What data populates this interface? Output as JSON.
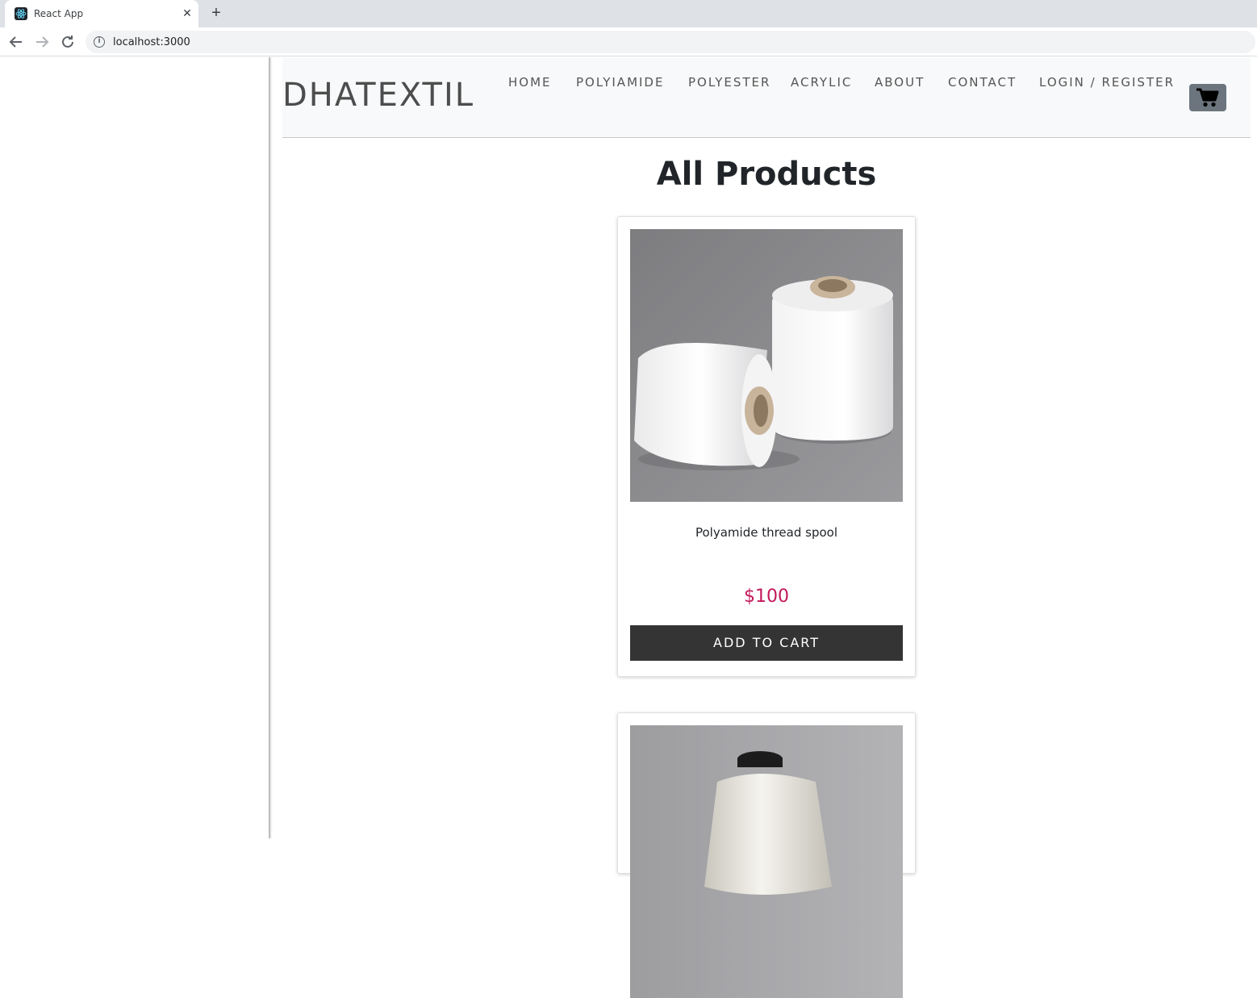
{
  "browser": {
    "tab_title": "React App",
    "tab_close": "✕",
    "new_tab": "+",
    "url": "localhost:3000",
    "info": "i"
  },
  "header": {
    "brand": "DHATEXTIL",
    "nav": [
      "HOME",
      "POLYIAMIDE",
      "POLYESTER",
      "ACRYLIC",
      "ABOUT",
      "CONTACT",
      "LOGIN / REGISTER"
    ],
    "cart_icon": "shopping-cart-icon"
  },
  "main": {
    "title": "All Products",
    "products": [
      {
        "name": "Polyamide thread spool",
        "price": "$100",
        "button": "ADD TO CART",
        "image": "white-thread-spools"
      },
      {
        "image": "white-thread-cone"
      }
    ]
  },
  "colors": {
    "price": "#c2185b",
    "button_bg": "#343434",
    "cart_bg": "#6c757d",
    "header_bg": "#f8f9fa"
  }
}
